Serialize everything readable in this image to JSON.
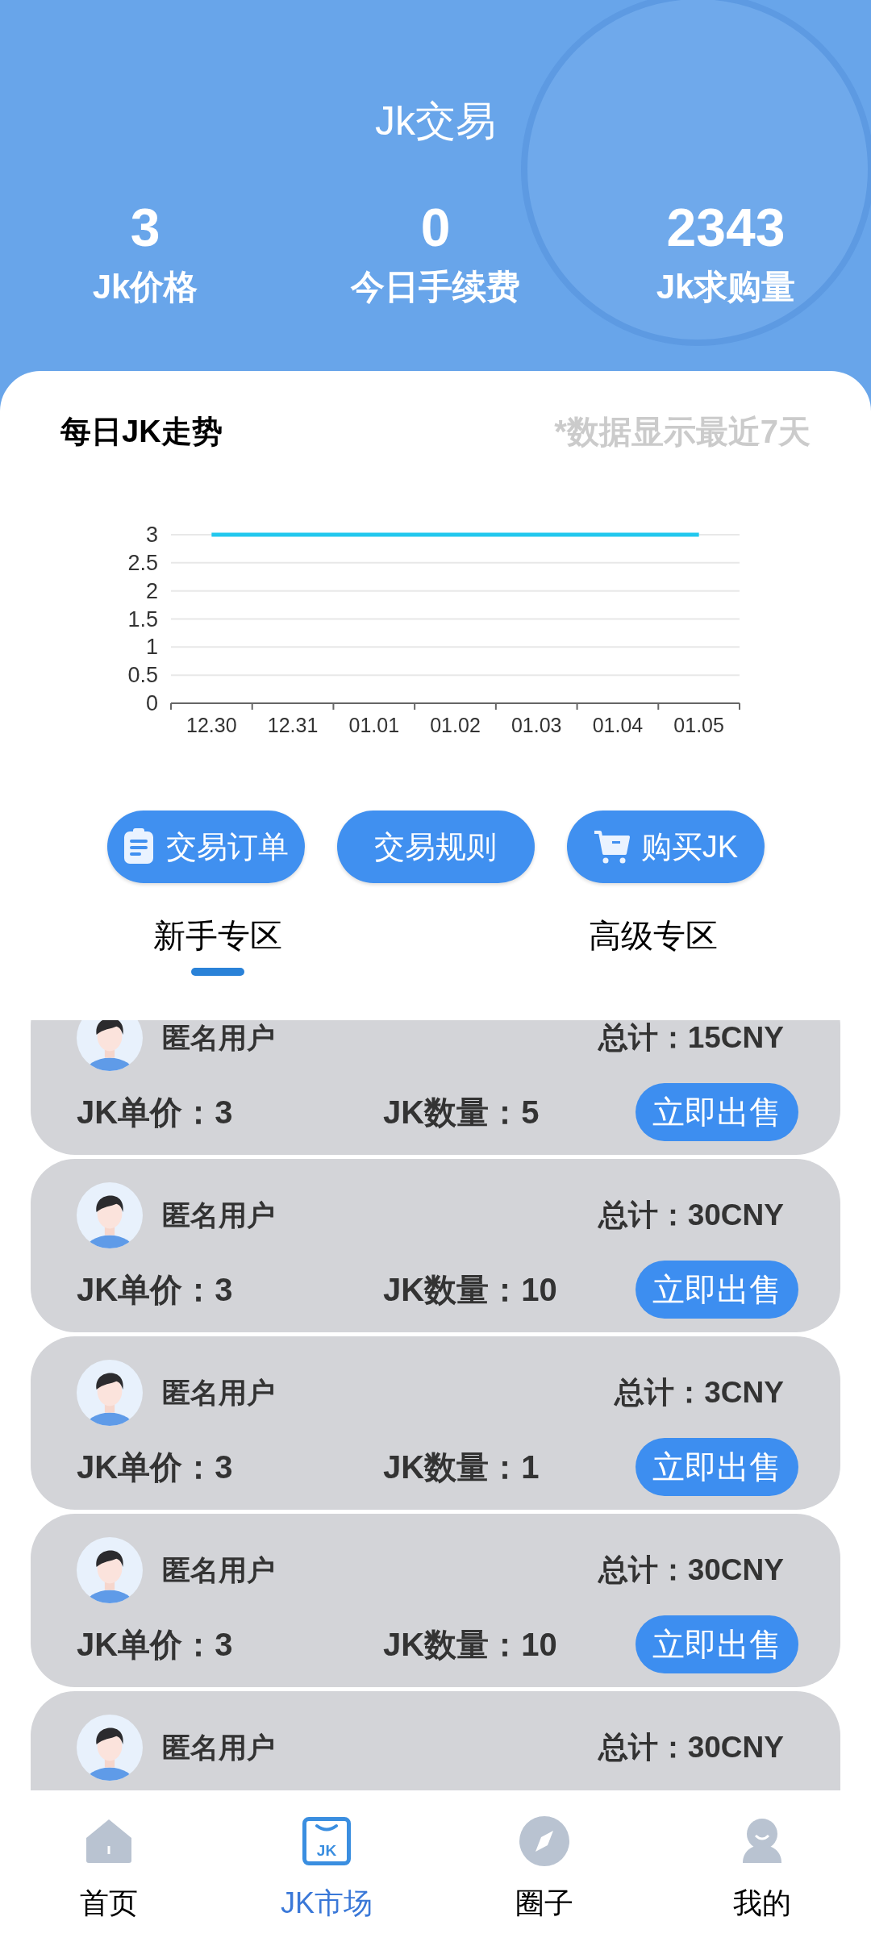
{
  "header": {
    "title": "Jk交易"
  },
  "stats": [
    {
      "value": "3",
      "label": "Jk价格"
    },
    {
      "value": "0",
      "label": "今日手续费"
    },
    {
      "value": "2343",
      "label": "Jk求购量"
    }
  ],
  "trend": {
    "title": "每日JK走势",
    "note": "*数据显示最近7天",
    "chart_data": {
      "type": "line",
      "categories": [
        "12.30",
        "12.31",
        "01.01",
        "01.02",
        "01.03",
        "01.04",
        "01.05"
      ],
      "series": [
        {
          "color": "#22c8ee",
          "values": [
            3,
            3,
            3,
            3,
            3,
            3,
            3
          ]
        }
      ],
      "grid": true,
      "ylim": [
        0,
        3
      ],
      "yticks": [
        0,
        0.5,
        1,
        1.5,
        2,
        2.5,
        3
      ]
    }
  },
  "actions": [
    {
      "kind": "orders",
      "label": "交易订单"
    },
    {
      "kind": "rules",
      "label": "交易规则"
    },
    {
      "kind": "buy",
      "label": "购买JK"
    }
  ],
  "tabs": [
    {
      "label": "新手专区",
      "selected": true
    },
    {
      "label": "高级专区",
      "selected": false
    }
  ],
  "orders": [
    {
      "user": "匿名用户",
      "total": "总计：15CNY",
      "price": "JK单价：3",
      "quantity": "JK数量：5",
      "action": "立即出售"
    },
    {
      "user": "匿名用户",
      "total": "总计：30CNY",
      "price": "JK单价：3",
      "quantity": "JK数量：10",
      "action": "立即出售"
    },
    {
      "user": "匿名用户",
      "total": "总计：3CNY",
      "price": "JK单价：3",
      "quantity": "JK数量：1",
      "action": "立即出售"
    },
    {
      "user": "匿名用户",
      "total": "总计：30CNY",
      "price": "JK单价：3",
      "quantity": "JK数量：10",
      "action": "立即出售"
    },
    {
      "user": "匿名用户",
      "total": "总计：30CNY"
    }
  ],
  "nav": [
    {
      "kind": "home",
      "label": "首页",
      "selected": false
    },
    {
      "kind": "market",
      "label": "JK市场",
      "icon_text": "JK",
      "selected": true
    },
    {
      "kind": "circle",
      "label": "圈子",
      "selected": false
    },
    {
      "kind": "me",
      "label": "我的",
      "selected": false
    }
  ]
}
